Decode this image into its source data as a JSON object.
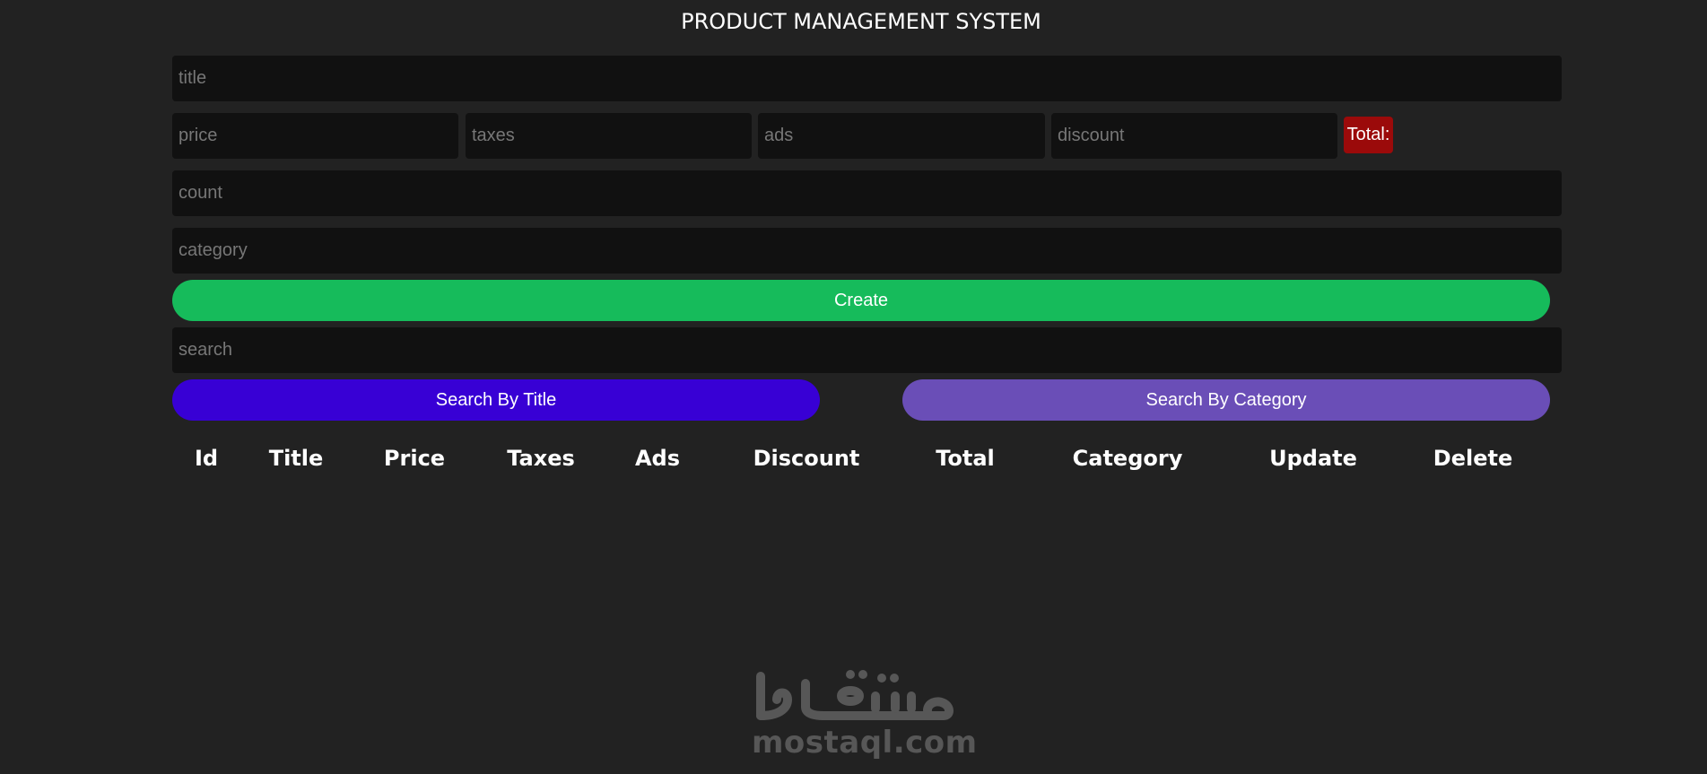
{
  "header": {
    "title": "PRODUCT MANAGEMENT SYSTEM"
  },
  "form": {
    "title_placeholder": "title",
    "price_placeholder": "price",
    "taxes_placeholder": "taxes",
    "ads_placeholder": "ads",
    "discount_placeholder": "discount",
    "total_label": "Total:",
    "count_placeholder": "count",
    "category_placeholder": "category",
    "create_label": "Create"
  },
  "search": {
    "placeholder": "search",
    "by_title_label": "Search By Title",
    "by_category_label": "Search By Category"
  },
  "table": {
    "headers": [
      "Id",
      "Title",
      "Price",
      "Taxes",
      "Ads",
      "Discount",
      "Total",
      "Category",
      "Update",
      "Delete"
    ]
  },
  "watermark": {
    "text": "mostaql.com",
    "arabic_text": "مستقل"
  },
  "colors": {
    "background": "#222222",
    "input_bg": "#111111",
    "total_badge": "#9b0a0a",
    "create_button": "#16bb5b",
    "search_title_button": "#3800d5",
    "search_category_button": "#6a4eb7"
  }
}
